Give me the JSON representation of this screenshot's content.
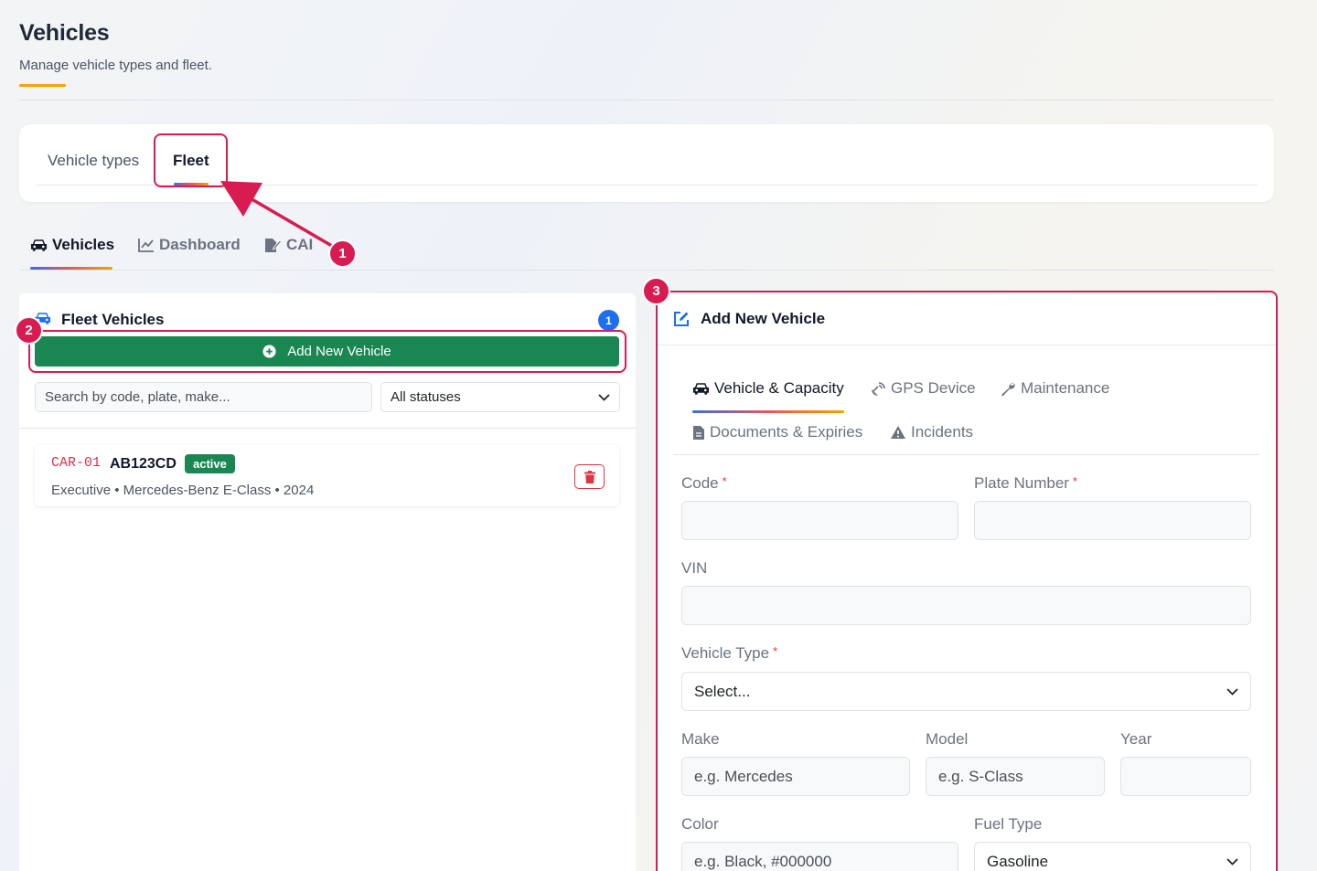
{
  "page": {
    "title": "Vehicles",
    "subtitle": "Manage vehicle types and fleet."
  },
  "main_tabs": {
    "vehicle_types": "Vehicle types",
    "fleet": "Fleet"
  },
  "sub_tabs": {
    "vehicles": "Vehicles",
    "dashboard": "Dashboard",
    "cai": "CAI"
  },
  "fleet_panel": {
    "title": "Fleet Vehicles",
    "count": "1",
    "add_button": "Add New Vehicle",
    "search_placeholder": "Search by code, plate, make...",
    "status_filter": "All statuses",
    "vehicles": [
      {
        "code": "CAR-01",
        "plate": "AB123CD",
        "status": "active",
        "meta": "Executive • Mercedes-Benz E-Class • 2024"
      }
    ]
  },
  "form": {
    "title": "Add New Vehicle",
    "tabs": {
      "vehicle_capacity": "Vehicle & Capacity",
      "gps_device": "GPS Device",
      "maintenance": "Maintenance",
      "documents": "Documents & Expiries",
      "incidents": "Incidents"
    },
    "fields": {
      "code_label": "Code",
      "plate_label": "Plate Number",
      "vin_label": "VIN",
      "vehicle_type_label": "Vehicle Type",
      "vehicle_type_value": "Select...",
      "make_label": "Make",
      "make_placeholder": "e.g. Mercedes",
      "model_label": "Model",
      "model_placeholder": "e.g. S-Class",
      "year_label": "Year",
      "color_label": "Color",
      "color_placeholder": "e.g. Black, #000000",
      "fuel_label": "Fuel Type",
      "fuel_value": "Gasoline",
      "required_mark": "*"
    }
  },
  "annotations": {
    "step1": "1",
    "step2": "2",
    "step3": "3"
  },
  "colors": {
    "accent_red": "#d81b50",
    "primary_green": "#1a8753",
    "badge_blue": "#1d6ff2"
  }
}
